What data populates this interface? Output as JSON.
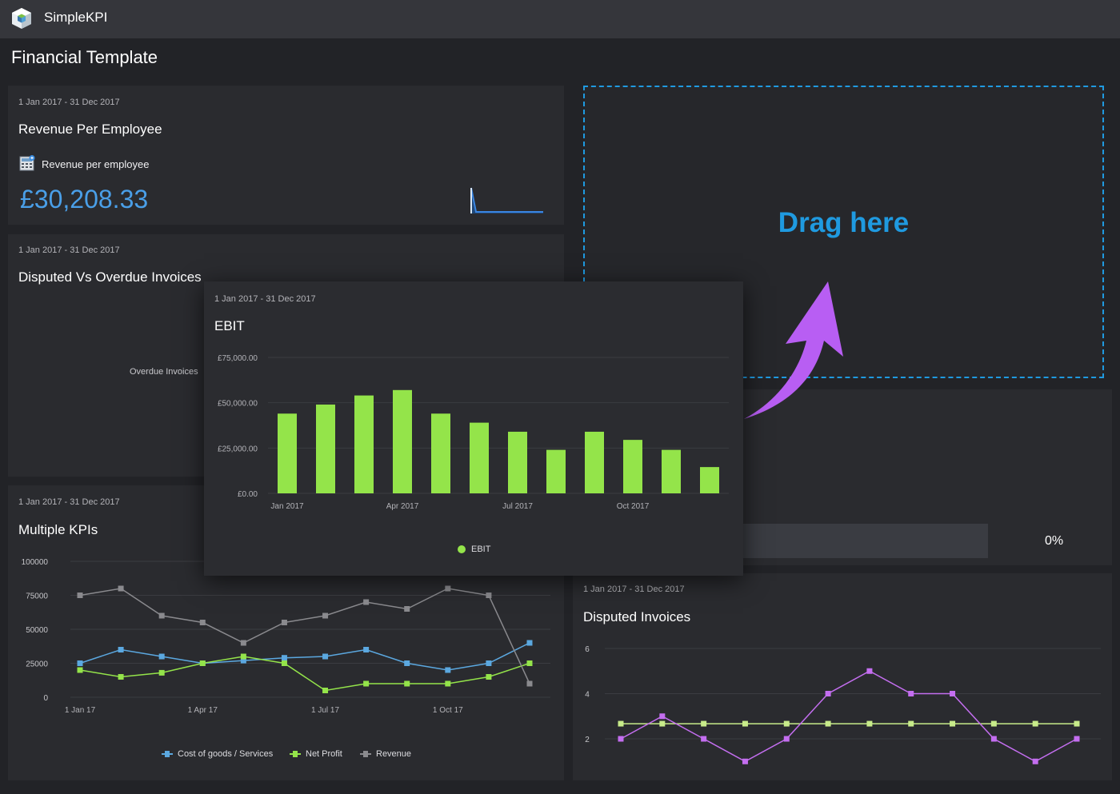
{
  "app": {
    "name": "SimpleKPI",
    "page_title": "Financial Template"
  },
  "colors": {
    "accent": "#1f9ae0",
    "ebit": "#94e44a",
    "arrow": "#b85ef3",
    "value": "#4a9fe8"
  },
  "cards": {
    "revenue": {
      "date": "1 Jan 2017 - 31 Dec 2017",
      "title": "Revenue Per Employee",
      "kpi_label": "Revenue per employee",
      "kpi_icon": "calculator-icon",
      "value": "£30,208.33"
    },
    "disputed_overdue": {
      "date": "1 Jan 2017 - 31 Dec 2017",
      "title": "Disputed Vs Overdue Invoices",
      "label": "Overdue Invoices"
    },
    "multiple": {
      "date": "1 Jan 2017 - 31 Dec 2017",
      "title": "Multiple KPIs"
    },
    "progress": {
      "value": "0%",
      "fraction": 0.0
    },
    "disputed": {
      "date": "1 Jan 2017 - 31 Dec 2017",
      "title": "Disputed Invoices"
    },
    "ebit": {
      "date": "1 Jan 2017 - 31 Dec 2017",
      "title": "EBIT"
    }
  },
  "dropzone": {
    "text": "Drag here"
  },
  "chart_data": [
    {
      "type": "bar",
      "x_tick_labels": [
        "Jan 2017",
        "Apr 2017",
        "Jul 2017",
        "Oct 2017"
      ],
      "y_tick_labels": [
        "£75,000.00",
        "£50,000.00",
        "£25,000.00",
        "£0.00"
      ],
      "ylim": [
        0,
        75000
      ],
      "series": [
        {
          "name": "EBIT",
          "values": [
            44000,
            49000,
            54000,
            57000,
            44000,
            39000,
            34000,
            24000,
            34000,
            29500,
            24000,
            14500
          ]
        }
      ],
      "legend": "bottom"
    },
    {
      "type": "line",
      "x_tick_labels": [
        "1 Jan 17",
        "1 Apr 17",
        "1 Jul 17",
        "1 Oct 17"
      ],
      "y_tick_labels": [
        "100000",
        "75000",
        "50000",
        "25000",
        "0"
      ],
      "ylim": [
        0,
        100000
      ],
      "series": [
        {
          "name": "Cost of goods / Services",
          "color": "#5ba8e0",
          "values": [
            25000,
            35000,
            30000,
            25000,
            27000,
            29000,
            30000,
            35000,
            25000,
            20000,
            25000,
            40000
          ]
        },
        {
          "name": "Net Profit",
          "color": "#94e44a",
          "values": [
            20000,
            15000,
            18000,
            25000,
            30000,
            25000,
            5000,
            10000,
            10000,
            10000,
            15000,
            25000
          ]
        },
        {
          "name": "Revenue",
          "color": "#8a8a8e",
          "values": [
            75000,
            80000,
            60000,
            55000,
            40000,
            55000,
            60000,
            70000,
            65000,
            80000,
            75000,
            10000
          ]
        }
      ],
      "legend": "bottom"
    },
    {
      "type": "line",
      "y_tick_labels": [
        "6",
        "4",
        "2"
      ],
      "ylim": [
        2,
        6
      ],
      "series": [
        {
          "color": "#c46ef0",
          "values": [
            2,
            3,
            2,
            1,
            2,
            4,
            5,
            4,
            4,
            2,
            1,
            2
          ]
        },
        {
          "color": "#c8ec8a",
          "values": [
            2.67,
            2.67,
            2.67,
            2.67,
            2.67,
            2.67,
            2.67,
            2.67,
            2.67,
            2.67,
            2.67,
            2.67
          ]
        }
      ]
    }
  ]
}
